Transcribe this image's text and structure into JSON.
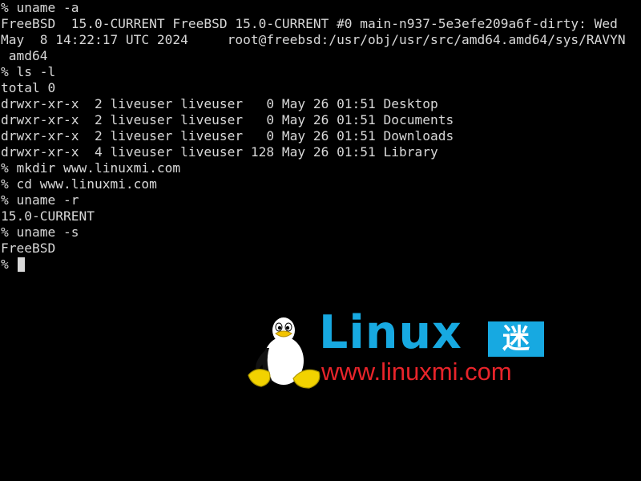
{
  "terminal": {
    "lines": [
      "% uname -a",
      "FreeBSD  15.0-CURRENT FreeBSD 15.0-CURRENT #0 main-n937-5e3efe209a6f-dirty: Wed",
      "May  8 14:22:17 UTC 2024     root@freebsd:/usr/obj/usr/src/amd64.amd64/sys/RAVYN",
      " amd64",
      "% ls -l",
      "total 0",
      "drwxr-xr-x  2 liveuser liveuser   0 May 26 01:51 Desktop",
      "drwxr-xr-x  2 liveuser liveuser   0 May 26 01:51 Documents",
      "drwxr-xr-x  2 liveuser liveuser   0 May 26 01:51 Downloads",
      "drwxr-xr-x  4 liveuser liveuser 128 May 26 01:51 Library",
      "% mkdir www.linuxmi.com",
      "% cd www.linuxmi.com",
      "% uname -r",
      "15.0-CURRENT",
      "% uname -s",
      "FreeBSD"
    ],
    "prompt": "% ",
    "colors": {
      "background": "#000000",
      "foreground": "#d8d8d8"
    }
  },
  "watermark": {
    "icon": "tux-penguin-icon",
    "brand": "Linux",
    "badge": "迷",
    "url": "www.linuxmi.com",
    "colors": {
      "brand": "#17a9e1",
      "badge_background": "#17a9e1",
      "url": "#e8242a"
    }
  }
}
